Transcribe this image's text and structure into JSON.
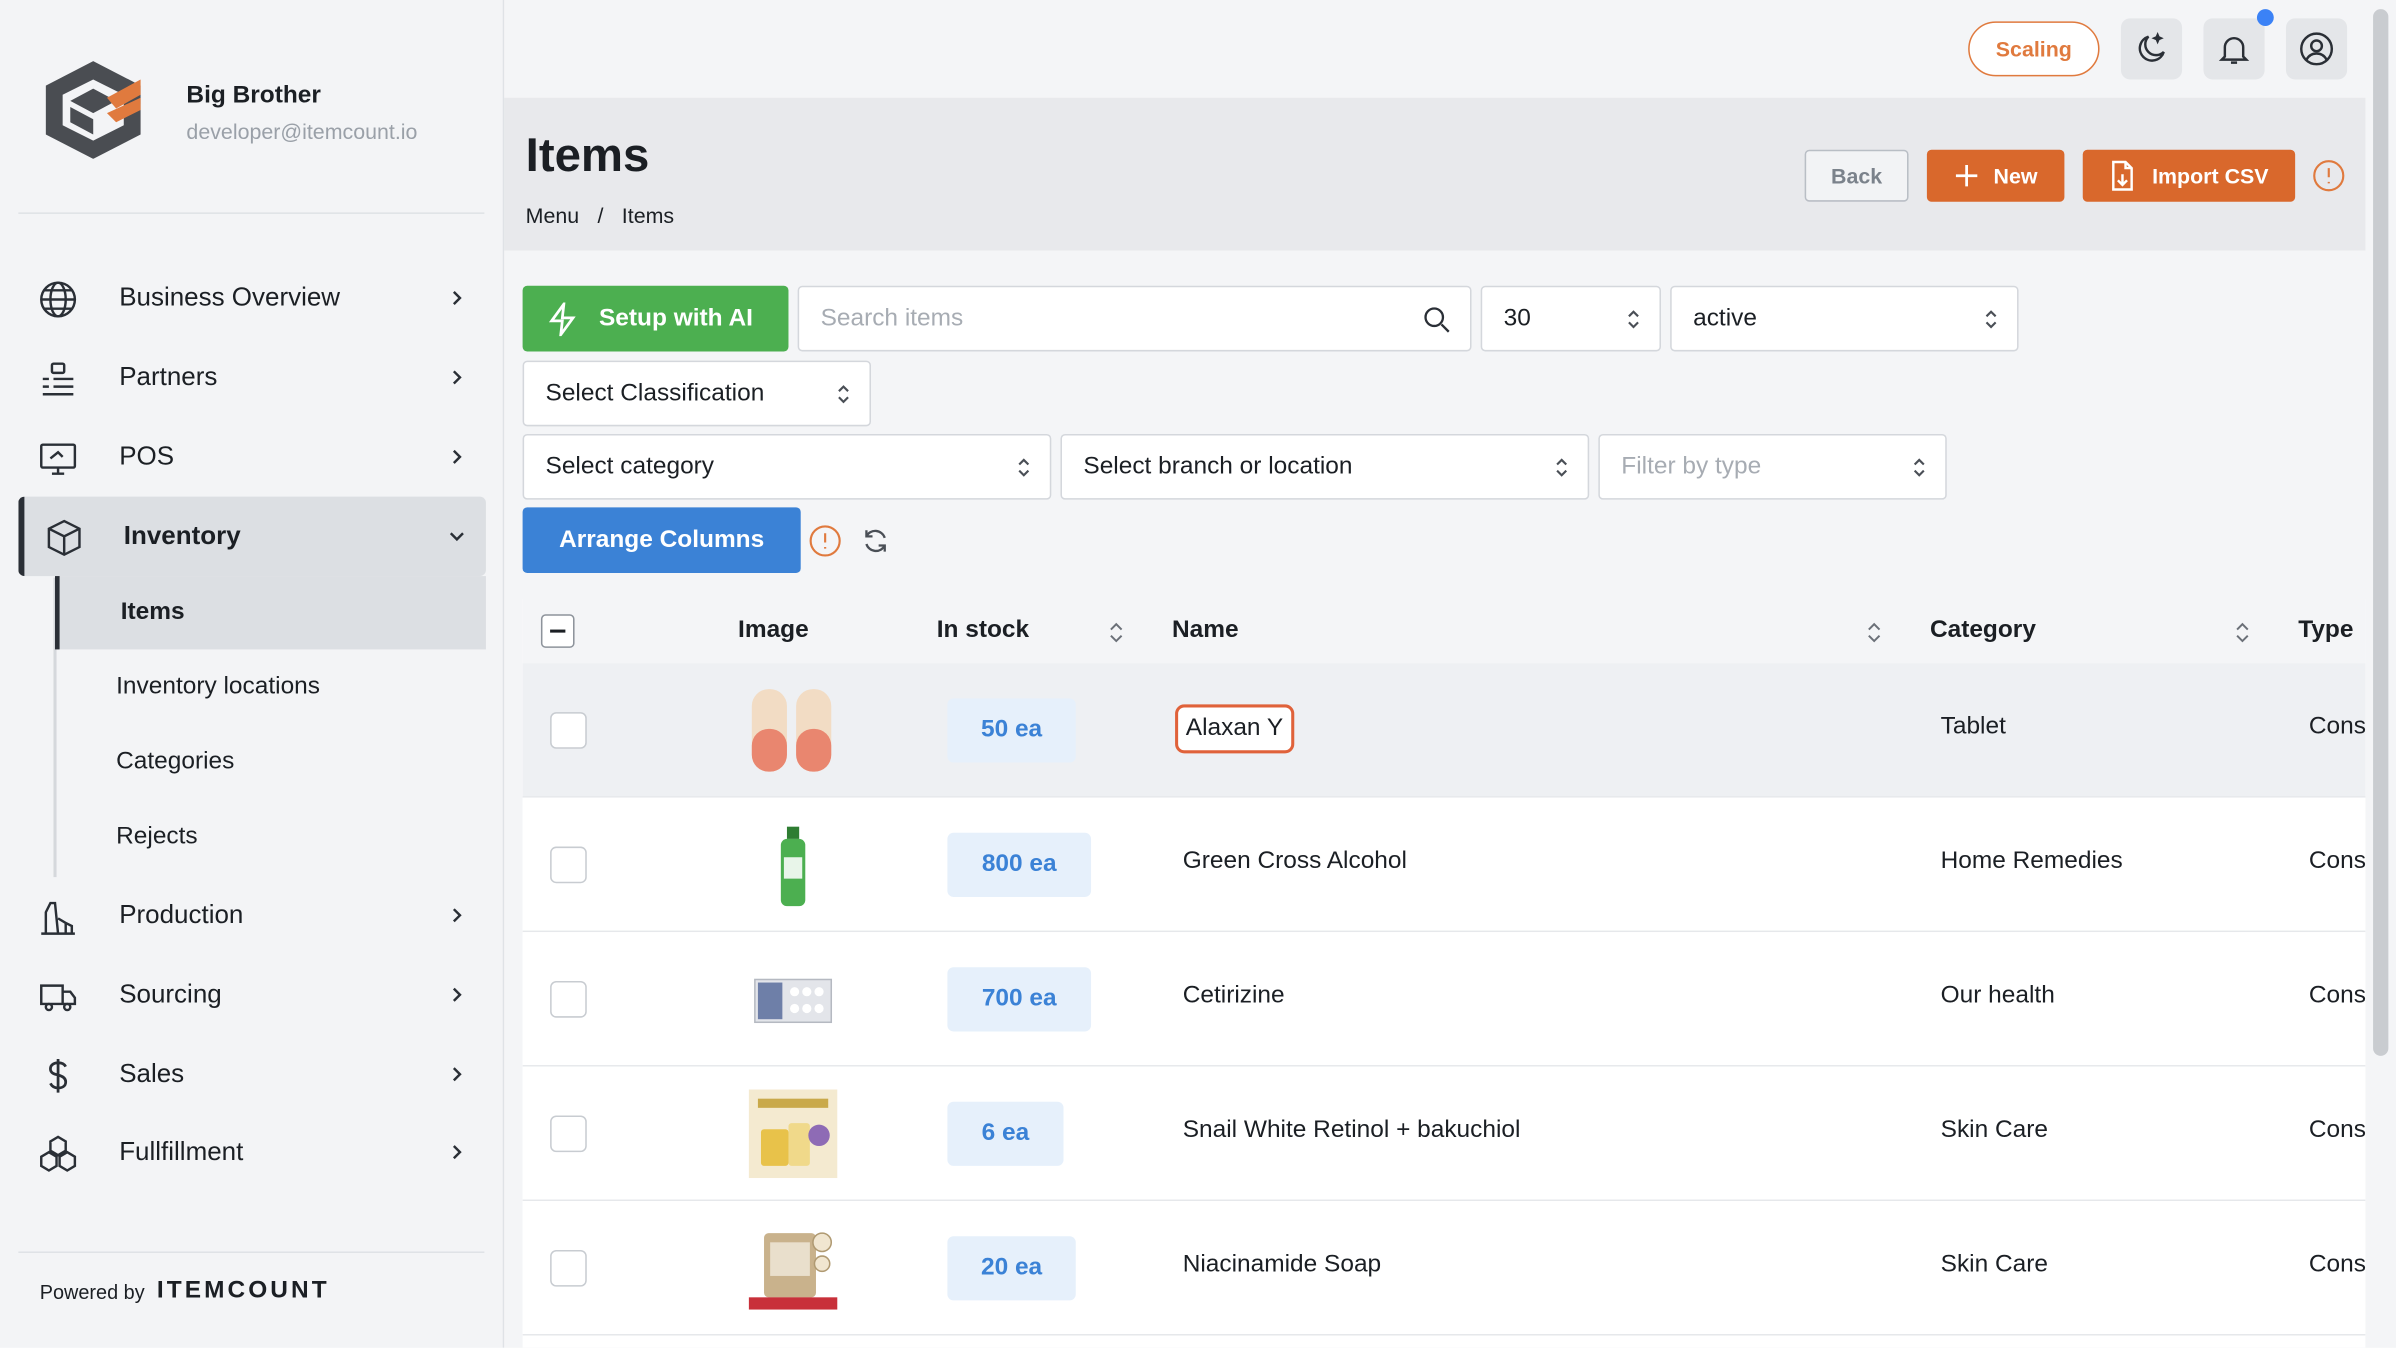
{
  "user": {
    "name": "Big Brother",
    "email": "developer@itemcount.io"
  },
  "sidebar": {
    "items": [
      {
        "label": "Business Overview",
        "icon": "globe-icon"
      },
      {
        "label": "Partners",
        "icon": "partners-icon"
      },
      {
        "label": "POS",
        "icon": "pos-icon"
      },
      {
        "label": "Inventory",
        "icon": "box-icon"
      },
      {
        "label": "Production",
        "icon": "factory-icon"
      },
      {
        "label": "Sourcing",
        "icon": "truck-icon"
      },
      {
        "label": "Sales",
        "icon": "dollar-icon"
      },
      {
        "label": "Fullfillment",
        "icon": "boxes-icon"
      }
    ],
    "inventory_sub": [
      "Items",
      "Inventory locations",
      "Categories",
      "Rejects"
    ],
    "powered_by": "Powered by",
    "powered_brand": "ITEMCOUNT"
  },
  "topbar": {
    "scaling": "Scaling"
  },
  "header": {
    "title": "Items",
    "crumb_1": "Menu",
    "crumb_sep": "/",
    "crumb_2": "Items",
    "back": "Back",
    "new": "New",
    "import": "Import CSV"
  },
  "filters": {
    "setup_ai": "Setup with AI",
    "search_placeholder": "Search items",
    "per_page": "30",
    "status": "active",
    "classification": "Select Classification",
    "category": "Select category",
    "branch": "Select branch or location",
    "type": "Filter by type",
    "arrange": "Arrange Columns"
  },
  "table": {
    "columns": {
      "image": "Image",
      "in_stock": "In stock",
      "name": "Name",
      "category": "Category",
      "type": "Type"
    },
    "rows": [
      {
        "stock": "50 ea",
        "name": "Alaxan Y",
        "category": "Tablet",
        "type": "Cons"
      },
      {
        "stock": "800 ea",
        "name": "Green Cross Alcohol",
        "category": "Home Remedies",
        "type": "Cons"
      },
      {
        "stock": "700 ea",
        "name": "Cetirizine",
        "category": "Our health",
        "type": "Cons"
      },
      {
        "stock": "6 ea",
        "name": "Snail White Retinol + bakuchiol",
        "category": "Skin Care",
        "type": "Cons"
      },
      {
        "stock": "20 ea",
        "name": "Niacinamide Soap",
        "category": "Skin Care",
        "type": "Cons"
      }
    ]
  },
  "colors": {
    "accent": "#d9682c",
    "primary": "#3b82d6",
    "ai": "#4caf50",
    "notif": "#3b82f6"
  }
}
